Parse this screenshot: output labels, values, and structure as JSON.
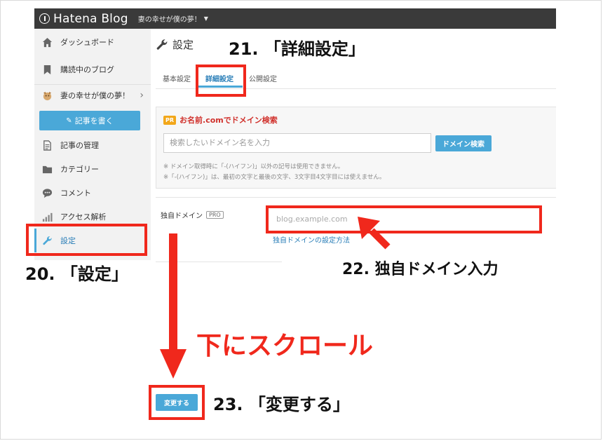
{
  "topbar": {
    "brand": "Hatena Blog",
    "blog_name": "妻の幸せが僕の夢！"
  },
  "sidebar": {
    "items": [
      {
        "label": "ダッシュボード",
        "icon": "home-icon"
      },
      {
        "label": "購読中のブログ",
        "icon": "bookmark-icon"
      },
      {
        "label": "妻の幸せが僕の夢！",
        "icon": "blog-avatar"
      },
      {
        "label": "記事の管理",
        "icon": "document-icon"
      },
      {
        "label": "カテゴリー",
        "icon": "folder-icon"
      },
      {
        "label": "コメント",
        "icon": "comment-icon"
      },
      {
        "label": "アクセス解析",
        "icon": "bar-chart-icon"
      },
      {
        "label": "設定",
        "icon": "wrench-icon"
      }
    ],
    "write_button": "記事を書く"
  },
  "main": {
    "title": "設定",
    "tabs": [
      {
        "label": "基本設定"
      },
      {
        "label": "詳細設定"
      },
      {
        "label": "公開設定"
      }
    ],
    "pr": {
      "badge": "PR",
      "heading": "お名前.comでドメイン検索",
      "placeholder": "検索したいドメイン名を入力",
      "button": "ドメイン検索",
      "note1": "※ ドメイン取得時に「-(ハイフン)」以外の記号は使用できません。",
      "note2": "※「-(ハイフン)」は、最初の文字と最後の文字、3文字目4文字目には使えません。"
    },
    "custom_domain": {
      "label": "独自ドメイン",
      "badge": "PRO",
      "placeholder": "blog.example.com",
      "help_link": "独自ドメインの設定方法"
    },
    "save_button": "変更する"
  },
  "annotations": {
    "step20": "20. 「設定」",
    "step21": "21. 「詳細設定」",
    "step22": "22. 独自ドメイン入力",
    "step23": "23. 「変更する」",
    "scroll": "下にスクロール"
  },
  "colors": {
    "accent": "#4aa8d8",
    "annotation": "#f0281c",
    "topbar": "#3a3a3a"
  }
}
